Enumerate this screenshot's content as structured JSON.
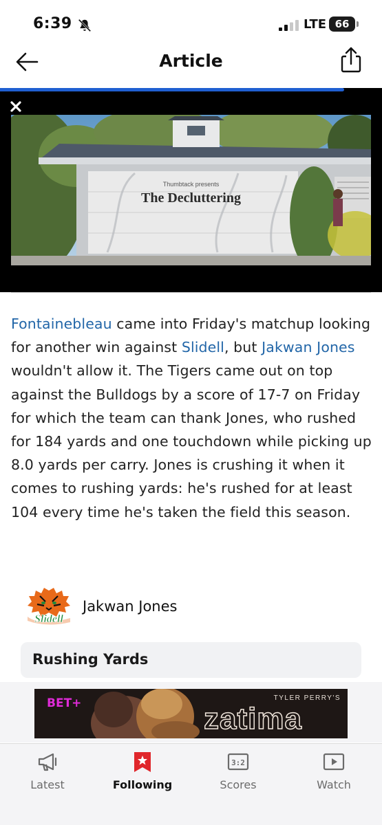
{
  "status_bar": {
    "time": "6:39",
    "network": "LTE",
    "battery": "66"
  },
  "nav": {
    "title": "Article",
    "reading_progress": 0.9
  },
  "video_ad": {
    "presenter": "Thumbtack presents",
    "title": "The Decluttering"
  },
  "article": {
    "p1_link_team": "Fontainebleau",
    "p1_text1": " came into Friday's matchup looking for another win against ",
    "p1_link_opponent": "Slidell",
    "p1_text2": ", but ",
    "p1_link_player": "Jakwan Jones",
    "p1_text3": " wouldn't allow it. The Tigers came out on top against the Bulldogs by a score of 17-7 on Friday for which the team can thank Jones, who rushed for 184 yards and one touchdown while picking up 8.0 yards per carry. Jones is crushing it when it comes to rushing yards: he's rushed for at least 104 every time he's taken the field this season."
  },
  "player_card": {
    "logo_text": "Slidell",
    "player_name": "Jakwan Jones",
    "stat_label": "Rushing Yards"
  },
  "ad_banner": {
    "brand": "BET+",
    "tagline": "TYLER PERRY'S",
    "title": "zatima"
  },
  "tabs": [
    {
      "label": "Latest",
      "icon": "megaphone-icon",
      "active": false
    },
    {
      "label": "Following",
      "icon": "bookmark-star-icon",
      "active": true
    },
    {
      "label": "Scores",
      "icon": "scoreboard-icon",
      "active": false
    },
    {
      "label": "Watch",
      "icon": "play-icon",
      "active": false
    }
  ],
  "colors": {
    "link": "#2266a8",
    "progress": "#1f5fd1",
    "following_accent": "#e0262b",
    "logo_orange": "#e86a1a",
    "logo_green": "#1c8a3c"
  }
}
